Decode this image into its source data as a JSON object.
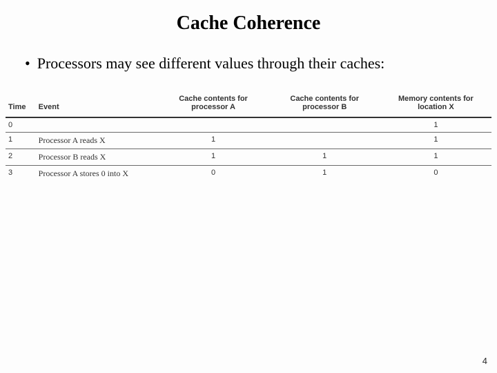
{
  "title": "Cache Coherence",
  "bullet": "Processors may see different values through their caches:",
  "table": {
    "headers": {
      "time": "Time",
      "event": "Event",
      "a": "Cache contents for processor A",
      "b": "Cache contents for processor B",
      "mem": "Memory contents for location X"
    },
    "rows": [
      {
        "time": "0",
        "event": "",
        "a": "",
        "b": "",
        "mem": "1"
      },
      {
        "time": "1",
        "event": "Processor A reads X",
        "a": "1",
        "b": "",
        "mem": "1"
      },
      {
        "time": "2",
        "event": "Processor B reads X",
        "a": "1",
        "b": "1",
        "mem": "1"
      },
      {
        "time": "3",
        "event": "Processor A stores 0 into X",
        "a": "0",
        "b": "1",
        "mem": "0"
      }
    ]
  },
  "page_number": "4"
}
